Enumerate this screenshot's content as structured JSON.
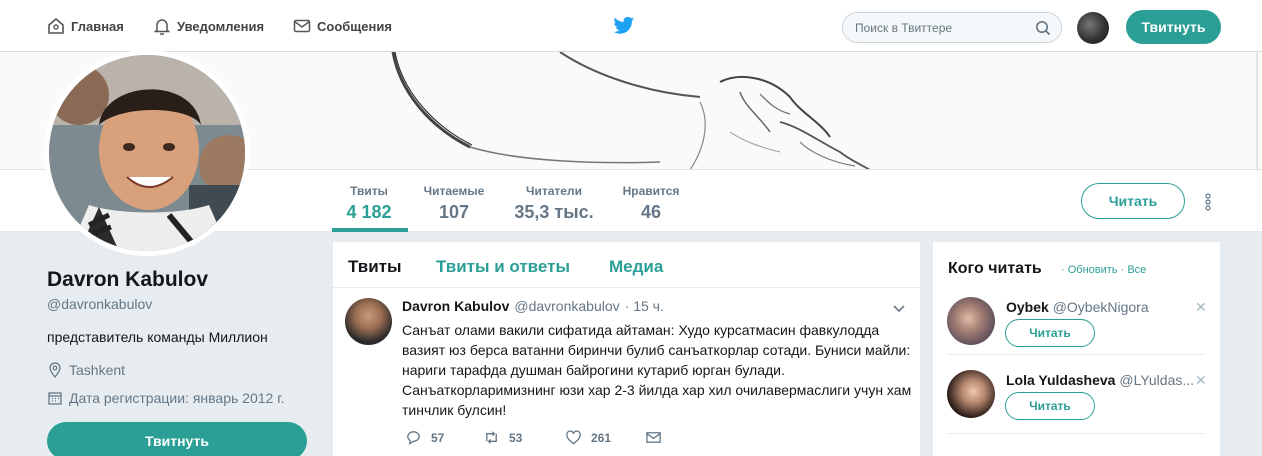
{
  "nav": {
    "home": "Главная",
    "notifications": "Уведомления",
    "messages": "Сообщения",
    "search_placeholder": "Поиск в Твиттере",
    "tweet_button": "Твитнуть"
  },
  "profile_nav": {
    "stats": [
      {
        "label": "Твиты",
        "value": "4 182"
      },
      {
        "label": "Читаемые",
        "value": "107"
      },
      {
        "label": "Читатели",
        "value": "35,3 тыс."
      },
      {
        "label": "Нравится",
        "value": "46"
      }
    ],
    "follow_button": "Читать"
  },
  "profile": {
    "name": "Davron Kabulov",
    "handle": "@davronkabulov",
    "bio": "представитель команды Миллион",
    "location": "Tashkent",
    "joined": "Дата регистрации: январь 2012 г.",
    "tweet_button": "Твитнуть"
  },
  "timeline": {
    "tabs": [
      "Твиты",
      "Твиты и ответы",
      "Медиа"
    ],
    "tweet": {
      "name": "Davron Kabulov",
      "handle": "@davronkabulov",
      "time": "· 15 ч.",
      "text": "Санъат олами вакили сифатида айтаман: Худо курсатмасин фавкулодда вазият юз берса ватанни биринчи булиб санъаткорлар сотади. Буниси майли: нариги тарафда душман байрогини кутариб юрган булади. Санъаткорларимизнинг юзи хар 2-3 йилда хар хил очилавермаслиги учун хам тинчлик булсин!",
      "replies": "57",
      "retweets": "53",
      "likes": "261"
    }
  },
  "who_to_follow": {
    "title": "Кого читать",
    "refresh": "Обновить",
    "all": "Все",
    "users": [
      {
        "name": "Oybek",
        "handle": "@OybekNigora",
        "button": "Читать"
      },
      {
        "name": "Lola Yuldasheva",
        "handle": "@LYuldas...",
        "button": "Читать"
      }
    ]
  },
  "colors": {
    "accent": "#2b9f95",
    "text": "#14171a",
    "muted": "#657786"
  }
}
